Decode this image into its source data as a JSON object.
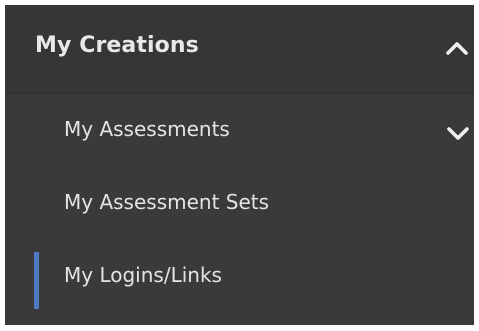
{
  "section": {
    "title": "My Creations",
    "expanded": true,
    "toggle_icon": "chevron-up-icon"
  },
  "items": [
    {
      "label": "My Assessments",
      "has_submenu": true,
      "submenu_icon": "chevron-down-icon",
      "active": false
    },
    {
      "label": "My Assessment Sets",
      "has_submenu": false,
      "active": false
    },
    {
      "label": "My Logins/Links",
      "has_submenu": false,
      "active": true
    }
  ],
  "colors": {
    "panel_bg": "#3a3a3b",
    "header_bg": "#363637",
    "text": "#e4e4e4",
    "active_indicator": "#4f79c3"
  }
}
